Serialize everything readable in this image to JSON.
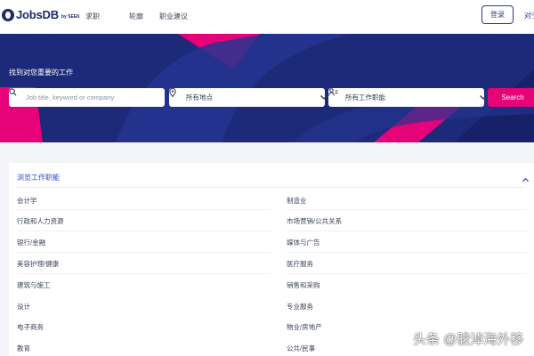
{
  "header": {
    "logo_text": "JobsDB",
    "logo_sub": "by SEEK",
    "nav": [
      "求职",
      "轮廓",
      "职业建议"
    ],
    "login_label": "登录",
    "about_label": "对于"
  },
  "hero": {
    "title": "找到对您重要的工作",
    "keyword_placeholder": "Job title, keyword or company",
    "location_value": "所有地点",
    "classification_value": "所有工作职能",
    "search_label": "Search"
  },
  "panel": {
    "title": "浏览工作职能",
    "left_categories": [
      "会计学",
      "行政和人力资源",
      "银行/金融",
      "美容护理/健康",
      "建筑与施工",
      "设计",
      "电子商务",
      "教育"
    ],
    "right_categories": [
      "制造业",
      "市场营销/公共关系",
      "媒体与广告",
      "医疗服务",
      "销售和采购",
      "专业服务",
      "物业/房地产",
      "公共/民事"
    ]
  },
  "watermark": "头条 @骏淖海外移",
  "colors": {
    "brand_navy": "#1d2a7a",
    "brand_pink": "#e60278",
    "link_blue": "#2a48c8"
  }
}
